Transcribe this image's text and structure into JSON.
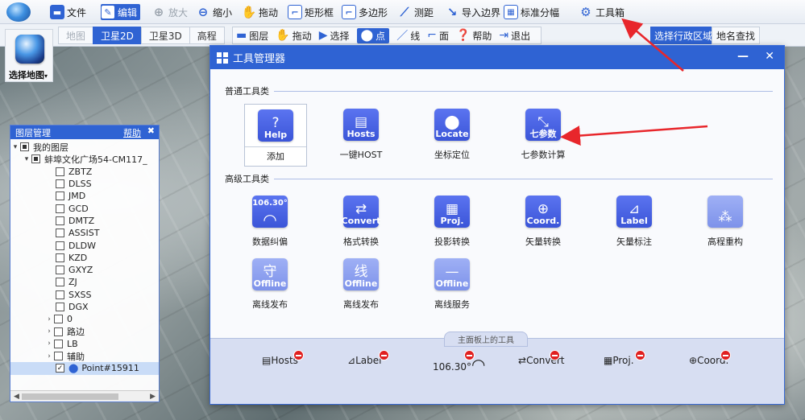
{
  "toolbar": {
    "file": "文件",
    "edit": "编辑",
    "zoom_in": "放大",
    "zoom_out": "缩小",
    "pan": "拖动",
    "rect_select": "矩形框",
    "polygon": "多边形",
    "measure": "测距",
    "import_boundary": "导入边界",
    "std_sheet": "标准分幅",
    "toolbox": "工具箱"
  },
  "map_tabs": [
    {
      "label": "地图",
      "state": "disabled"
    },
    {
      "label": "卫星2D",
      "state": "active"
    },
    {
      "label": "卫星3D",
      "state": "normal"
    },
    {
      "label": "高程",
      "state": "normal"
    }
  ],
  "row2_tools": {
    "layers": "图层",
    "pan": "拖动",
    "select": "选择",
    "point": "点",
    "line": "线",
    "area": "面",
    "help": "帮助",
    "exit": "退出"
  },
  "region_button": "选择行政区域",
  "place_search": "地名查找",
  "select_map_label": "选择地图",
  "layer_panel": {
    "title": "图层管理",
    "help": "帮助",
    "close": "✖",
    "root": "我的图层",
    "group": "蚌埠文化广场54-CM117_",
    "layers": [
      "ZBTZ",
      "DLSS",
      "JMD",
      "GCD",
      "DMTZ",
      "ASSIST",
      "DLDW",
      "KZD",
      "GXYZ",
      "ZJ",
      "SXSS",
      "DGX"
    ],
    "collapsed": [
      "0",
      "路边",
      "LB",
      "辅助"
    ],
    "selected_item": "Point#15911"
  },
  "dialog": {
    "title": "工具管理器",
    "section_common": "普通工具类",
    "section_advanced": "高级工具类",
    "panel_label": "主面板上的工具",
    "common_tools": [
      {
        "caption": "Help",
        "glyph": "?",
        "name": "添加"
      },
      {
        "caption": "Hosts",
        "glyph": "▤",
        "name": "一键HOST"
      },
      {
        "caption": "Locate",
        "glyph": "⬤",
        "name": "坐标定位"
      },
      {
        "caption": "七参数",
        "glyph": "⤡",
        "name": "七参数计算"
      }
    ],
    "advanced_tools": [
      {
        "caption": "106.30°",
        "glyph": "◠",
        "name": "数据纠偏"
      },
      {
        "caption": "Convert",
        "glyph": "⇄",
        "name": "格式转换"
      },
      {
        "caption": "Proj.",
        "glyph": "▦",
        "name": "投影转换"
      },
      {
        "caption": "Coord.",
        "glyph": "⊕",
        "name": "矢量转换"
      },
      {
        "caption": "Label",
        "glyph": "⊿",
        "name": "矢量标注"
      },
      {
        "caption": "",
        "glyph": "⁂",
        "name": "高程重构"
      },
      {
        "caption": "Offline",
        "glyph": "守",
        "name": "离线发布"
      },
      {
        "caption": "Offline",
        "glyph": "线",
        "name": "离线发布"
      },
      {
        "caption": "Offline",
        "glyph": "—",
        "name": "离线服务"
      }
    ],
    "panel_tools": [
      {
        "caption": "Hosts",
        "glyph": "▤"
      },
      {
        "caption": "Label",
        "glyph": "⊿"
      },
      {
        "caption": "106.30°",
        "glyph": "◠"
      },
      {
        "caption": "Convert",
        "glyph": "⇄"
      },
      {
        "caption": "Proj.",
        "glyph": "▦"
      },
      {
        "caption": "Coord.",
        "glyph": "⊕"
      }
    ]
  },
  "colors": {
    "accent": "#2f63d3",
    "tile": "#4a64e4",
    "remove": "#e02020",
    "arrow": "#e8262b"
  }
}
